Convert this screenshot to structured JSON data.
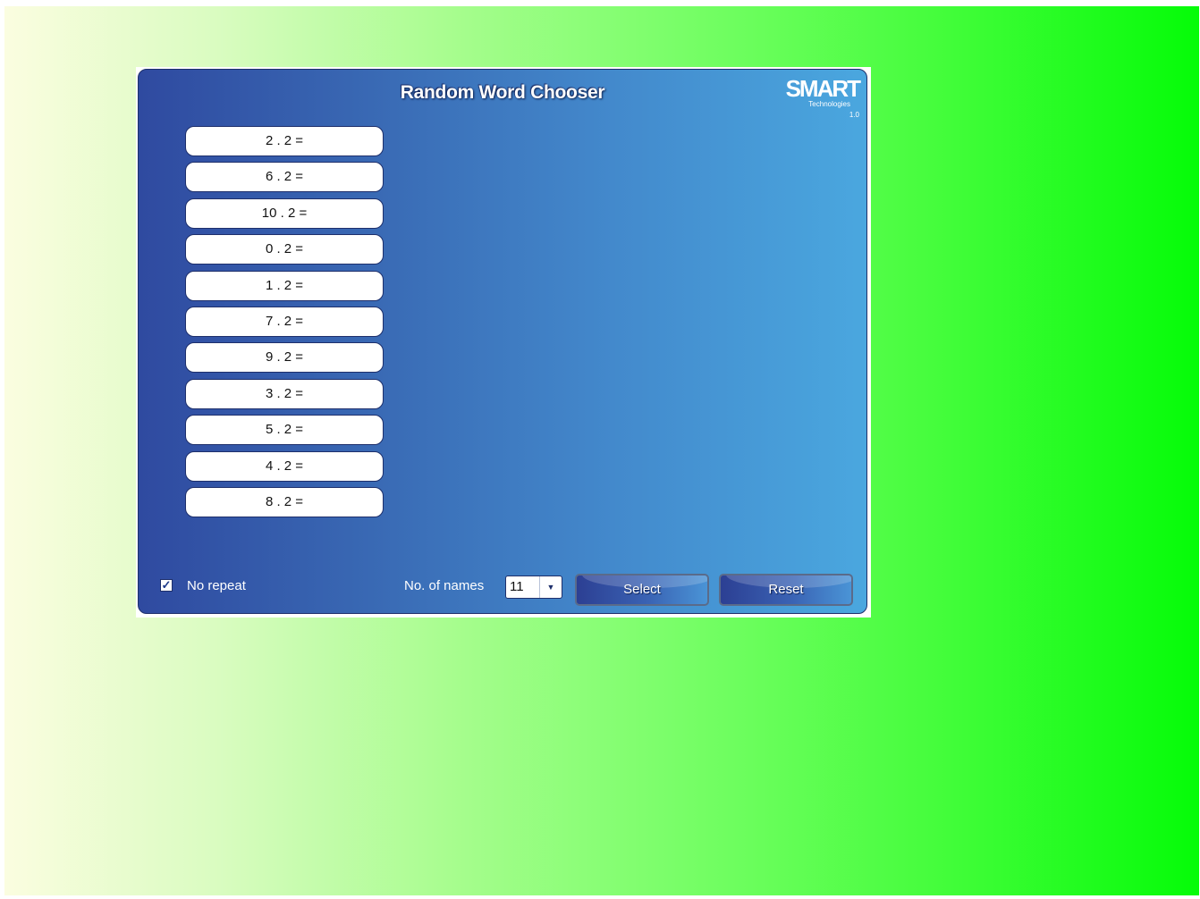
{
  "widget": {
    "title": "Random Word Chooser",
    "logo": {
      "brand": "SMART",
      "subtitle": "Technologies",
      "version": "1.0"
    }
  },
  "words": [
    "2 . 2 =",
    "6 . 2 =",
    "10 . 2 =",
    "0 . 2 =",
    "1 . 2 =",
    "7 . 2 =",
    "9 . 2 =",
    "3 . 2 =",
    "5 . 2 =",
    "4 . 2 =",
    "8 . 2 ="
  ],
  "controls": {
    "no_repeat_label": "No repeat",
    "no_repeat_checked": true,
    "names_label": "No. of names",
    "names_value": "11",
    "select_label": "Select",
    "reset_label": "Reset"
  },
  "colors": {
    "panel_start": "#2f4aa0",
    "panel_end": "#4aa7df",
    "background_start": "#fbfde0",
    "background_end": "#05fc08"
  }
}
